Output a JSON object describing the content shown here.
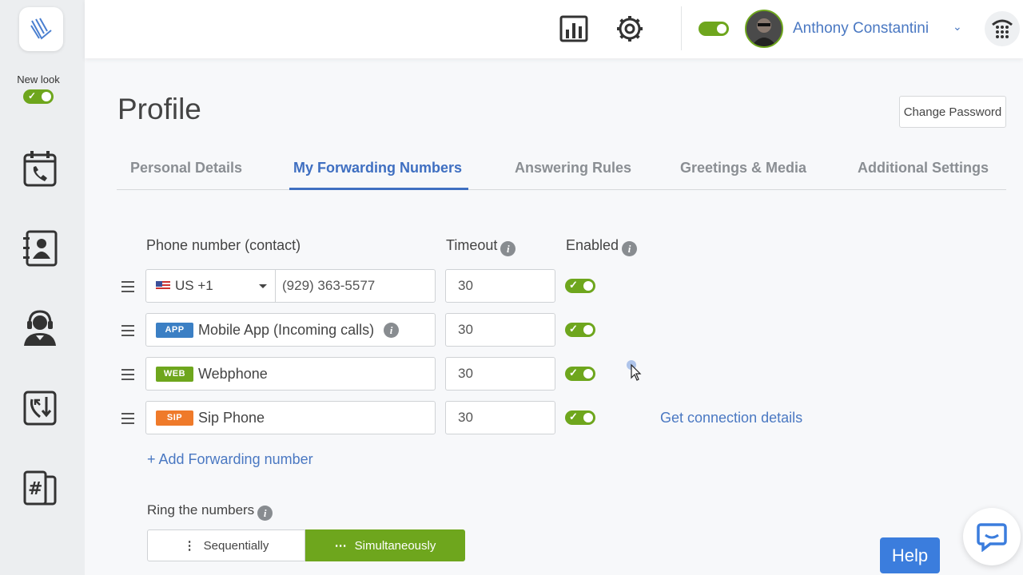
{
  "sidebar": {
    "new_look_label": "New look",
    "new_look_enabled": true,
    "items": [
      {
        "icon": "calendar-phone-icon"
      },
      {
        "icon": "contacts-book-icon"
      },
      {
        "icon": "agent-headset-icon"
      },
      {
        "icon": "call-routing-icon"
      },
      {
        "icon": "numbers-phone-icon"
      }
    ]
  },
  "header": {
    "analytics_icon": "bar-chart-icon",
    "settings_icon": "gear-icon",
    "status_toggle_enabled": true,
    "user_name": "Anthony Constantini",
    "user_menu_icon": "chevron-down-icon",
    "dialpad_icon": "dialpad-icon"
  },
  "page": {
    "title": "Profile",
    "change_password_label": "Change Password"
  },
  "tabs": [
    {
      "label": "Personal Details",
      "active": false
    },
    {
      "label": "My Forwarding Numbers",
      "active": true
    },
    {
      "label": "Answering Rules",
      "active": false
    },
    {
      "label": "Greetings & Media",
      "active": false
    },
    {
      "label": "Additional Settings",
      "active": false
    }
  ],
  "columns": {
    "phone": "Phone number (contact)",
    "timeout": "Timeout",
    "enabled": "Enabled"
  },
  "rows": [
    {
      "type": "phone",
      "country": "US +1",
      "number": "(929) 363-5577",
      "timeout": "30",
      "enabled": true
    },
    {
      "type": "app",
      "badge": "APP",
      "badge_color": "#3b7fc4",
      "label": "Mobile App (Incoming calls)",
      "timeout": "30",
      "enabled": true
    },
    {
      "type": "web",
      "badge": "WEB",
      "badge_color": "#6ea61d",
      "label": "Webphone",
      "timeout": "30",
      "enabled": true
    },
    {
      "type": "sip",
      "badge": "SIP",
      "badge_color": "#ef7a2a",
      "label": "Sip Phone",
      "timeout": "30",
      "enabled": true,
      "link": "Get connection details"
    }
  ],
  "add_forwarding_label": "+ Add Forwarding number",
  "ring": {
    "label": "Ring the numbers",
    "options": [
      {
        "label": "Sequentially",
        "selected": false
      },
      {
        "label": "Simultaneously",
        "selected": true
      }
    ]
  },
  "help_label": "Help",
  "colors": {
    "accent": "#3f6fc1",
    "toggle_on": "#6ea61d",
    "link": "#4a78c2"
  }
}
